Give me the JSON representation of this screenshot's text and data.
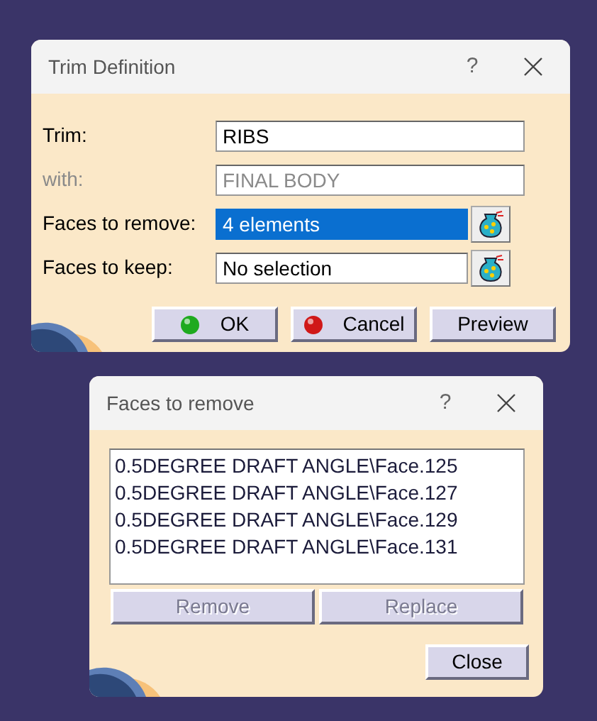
{
  "dialogs": [
    {
      "title": "Trim Definition",
      "help": "?",
      "fields": [
        {
          "label": "Trim:",
          "value": "RIBS",
          "disabled": false,
          "selected": false,
          "picker": false
        },
        {
          "label": "with:",
          "value": "FINAL BODY",
          "disabled": true,
          "selected": false,
          "picker": false
        },
        {
          "label": "Faces to remove:",
          "value": "4 elements",
          "disabled": false,
          "selected": true,
          "picker": true
        },
        {
          "label": "Faces to keep:",
          "value": "No selection",
          "disabled": false,
          "selected": false,
          "picker": true
        }
      ],
      "buttons": [
        {
          "label": "OK",
          "color": "#1faa1f",
          "disabled": false
        },
        {
          "label": "Cancel",
          "color": "#d01818",
          "disabled": false
        },
        {
          "label": "Preview",
          "disabled": false
        }
      ]
    },
    {
      "title": "Faces to remove",
      "help": "?",
      "list": [
        "0.5DEGREE DRAFT ANGLE\\Face.125",
        "0.5DEGREE DRAFT ANGLE\\Face.127",
        "0.5DEGREE DRAFT ANGLE\\Face.129",
        "0.5DEGREE DRAFT ANGLE\\Face.131"
      ],
      "list_buttons": [
        {
          "label": "Remove",
          "disabled": true
        },
        {
          "label": "Replace",
          "disabled": true
        }
      ],
      "buttons": [
        {
          "label": "Close",
          "disabled": false
        }
      ]
    }
  ]
}
